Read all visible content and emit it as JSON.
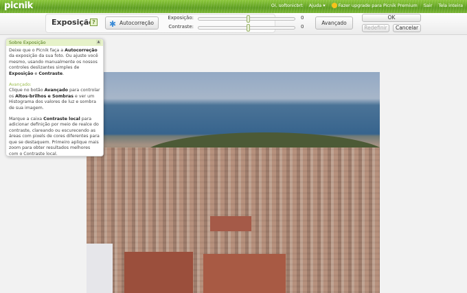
{
  "header": {
    "logo": "picnik",
    "greeting": "Oi, softonicbrt",
    "help": "Ajuda ▾",
    "upgrade": "Fazer upgrade para Picnik Premium",
    "logout": "Sair",
    "fullscreen": "Tela inteira"
  },
  "toolbar": {
    "title": "Exposição",
    "help_icon": "?",
    "autocorrect": "Autocorreção",
    "exposure_label": "Exposição:",
    "exposure_value": "0",
    "contrast_label": "Contraste:",
    "contrast_value": "0",
    "advanced": "Avançado",
    "ok": "OK",
    "reset": "Redefinir",
    "cancel": "Cancelar"
  },
  "help": {
    "title": "Sobre Exposição",
    "p1": [
      {
        "t": "Deixe que o Picnik faça a "
      },
      {
        "t": "Autocorreção",
        "b": true
      },
      {
        "t": " da exposição da sua foto. Ou ajuste você mesmo, usando manualmente os nossos controles deslizantes simples de "
      },
      {
        "t": "Exposição",
        "b": true
      },
      {
        "t": " e "
      },
      {
        "t": "Contraste",
        "b": true
      },
      {
        "t": "."
      }
    ],
    "subtitle": "Avançado:",
    "p2": [
      {
        "t": "Clique no botão "
      },
      {
        "t": "Avançado",
        "b": true
      },
      {
        "t": " para controlar os "
      },
      {
        "t": "Altos-brilhos e Sombras",
        "b": true
      },
      {
        "t": " e ver um Histograma dos valores de luz e sombra de sua imagem."
      }
    ],
    "p3": [
      {
        "t": "Marque a caixa "
      },
      {
        "t": "Contraste local",
        "b": true
      },
      {
        "t": " para adicionar definição por meio de realce do contraste, clareando ou escurecendo as áreas com pixels de cores diferentes para que se destaquem. Primeiro aplique mais zoom para obter resultados melhores com o Contraste local."
      }
    ]
  },
  "slider_levels": {
    "exposure": 0,
    "contrast": 0
  }
}
